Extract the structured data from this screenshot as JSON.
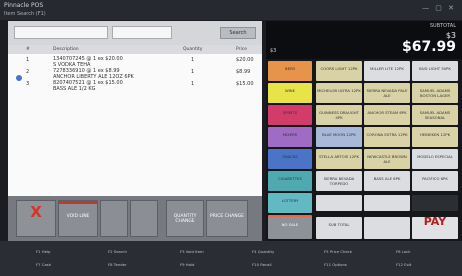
{
  "window": {
    "title": "Pinnacle POS",
    "subtitle": "Item Search (F1)",
    "controls": "— ▢ ✕"
  },
  "left": {
    "search_placeholder": "",
    "search_label": "Search",
    "grid_headers": {
      "num": "#",
      "desc": "Description",
      "qty": "Quantity",
      "price": "Price"
    },
    "lines": [
      {
        "num": "1",
        "desc1": "1340707245 @ 1 ex $20.00",
        "desc2": "S VODKA TEHA",
        "qty": "1",
        "amt": "$20.00"
      },
      {
        "num": "2",
        "desc1": "7278336910 @ 1 ex $8.99",
        "desc2": "ANCHOR LIBERTY ALE 12OZ 6PK",
        "qty": "1",
        "amt": "$8.99"
      },
      {
        "num": "3",
        "desc1": "8207407521 @ 1 ex $15.00",
        "desc2": "BASS ALE 1/2 KG",
        "qty": "1",
        "amt": "$15.00"
      }
    ],
    "fkeys": {
      "cancel": "X",
      "void": "VOID LINE",
      "qty": "QUANTITY CHANGE",
      "price": "PRICE CHANGE"
    }
  },
  "right": {
    "display": {
      "line1": "SUBTOTAL",
      "line2": "$3",
      "total": "$67.99",
      "left": "$3"
    },
    "categories": [
      "BEER",
      "WINE",
      "SPIRITS",
      "MIXERS",
      "SNACKS",
      "CIGARETTES",
      "LOTTERY",
      "ICE/WATER",
      "MISC",
      "OTHER",
      "MORE"
    ],
    "products": [
      [
        "COORS LIGHT 12PK",
        "MILLER LITE 12PK",
        "BUD LIGHT 30PK"
      ],
      [
        "MICHELOB ULTRA 12PK",
        "SIERRA NEVADA PALE ALE",
        "SAMUEL ADAMS BOSTON LAGER"
      ],
      [
        "GUINNESS DRAUGHT 4PK",
        "ANCHOR STEAM 6PK",
        "SAMUEL ADAMS SEASONAL"
      ],
      [
        "BLUE MOON 12PK",
        "CORONA EXTRA 12PK",
        "HEINEKEN 12PK"
      ],
      [
        "STELLA ARTOIS 12PK",
        "NEWCASTLE BROWN ALE",
        "MODELO ESPECIAL"
      ],
      [
        "SIERRA NEVADA TORPEDO",
        "BASS ALE 6PK",
        "PACIFICO 6PK"
      ]
    ],
    "bottom": {
      "k1": "NO SALE",
      "k2": "SUB TOTAL",
      "k3": "",
      "pay": "PAY"
    }
  },
  "footer": [
    [
      "F1 Help",
      "F2 Search",
      "F3 Void Item",
      "F4 Quantity",
      "F5 Price Check",
      "F6 Lock"
    ],
    [
      "F7 Cash",
      "F8 Tender",
      "F9 Hold",
      "F10 Recall",
      "F11 Options",
      "F12 Exit"
    ]
  ]
}
